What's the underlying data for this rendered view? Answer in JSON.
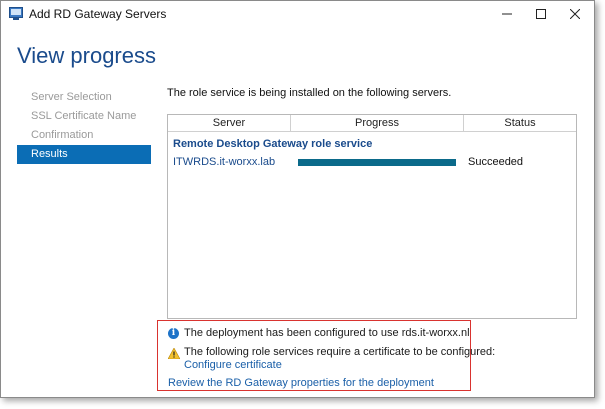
{
  "window": {
    "title": "Add RD Gateway Servers",
    "minimize_glyph": "—",
    "maximize_glyph": "☐",
    "close_glyph": "✕"
  },
  "page": {
    "heading": "View progress"
  },
  "nav": {
    "items": [
      {
        "label": "Server Selection",
        "active": false
      },
      {
        "label": "SSL Certificate Name",
        "active": false
      },
      {
        "label": "Confirmation",
        "active": false
      },
      {
        "label": "Results",
        "active": true
      }
    ]
  },
  "main": {
    "intro": "The role service is being installed on the following servers.",
    "table": {
      "headers": {
        "server": "Server",
        "progress": "Progress",
        "status": "Status"
      },
      "group_label": "Remote Desktop Gateway role service",
      "rows": [
        {
          "server": "ITWRDS.it-worxx.lab",
          "progress": 1.0,
          "status": "Succeeded"
        }
      ]
    }
  },
  "notice": {
    "info_text": "The deployment has been configured to use rds.it-worxx.nl",
    "warning_text": "The following role services require a certificate to be configured:",
    "configure_link": "Configure certificate",
    "review_link": "Review the RD Gateway properties for the deployment"
  },
  "colors": {
    "accent": "#0b6db5",
    "progress_fill": "#0b6a8a",
    "heading": "#1a4b8c",
    "link": "#1a5fa8",
    "highlight_border": "#d9332f"
  },
  "icons": {
    "app": "server-manager-icon",
    "info": "info-icon",
    "warning": "warning-icon"
  }
}
